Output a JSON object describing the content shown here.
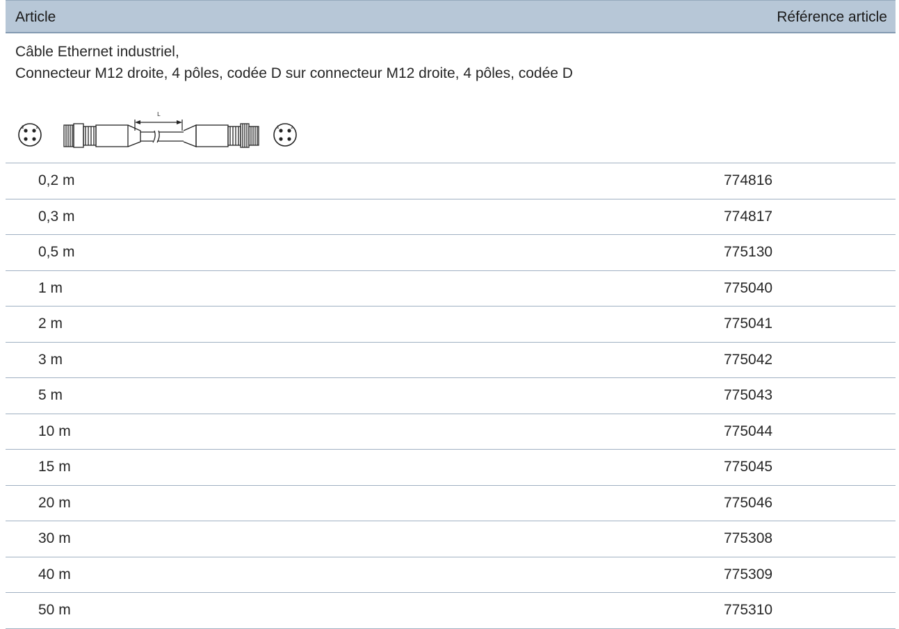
{
  "header": {
    "article_label": "Article",
    "reference_label": "Référence article"
  },
  "description": {
    "line1": "Câble Ethernet industriel,",
    "line2": "Connecteur M12 droite, 4 pôles, codée D sur connecteur M12 droite, 4 pôles, codée D"
  },
  "drawing": {
    "length_label": "L"
  },
  "rows": [
    {
      "length": "0,2 m",
      "reference": "774816"
    },
    {
      "length": "0,3 m",
      "reference": "774817"
    },
    {
      "length": "0,5 m",
      "reference": "775130"
    },
    {
      "length": "1 m",
      "reference": "775040"
    },
    {
      "length": "2 m",
      "reference": "775041"
    },
    {
      "length": "3 m",
      "reference": "775042"
    },
    {
      "length": "5 m",
      "reference": "775043"
    },
    {
      "length": "10 m",
      "reference": "775044"
    },
    {
      "length": "15 m",
      "reference": "775045"
    },
    {
      "length": "20 m",
      "reference": "775046"
    },
    {
      "length": "30 m",
      "reference": "775308"
    },
    {
      "length": "40 m",
      "reference": "775309"
    },
    {
      "length": "50 m",
      "reference": "775310"
    }
  ]
}
